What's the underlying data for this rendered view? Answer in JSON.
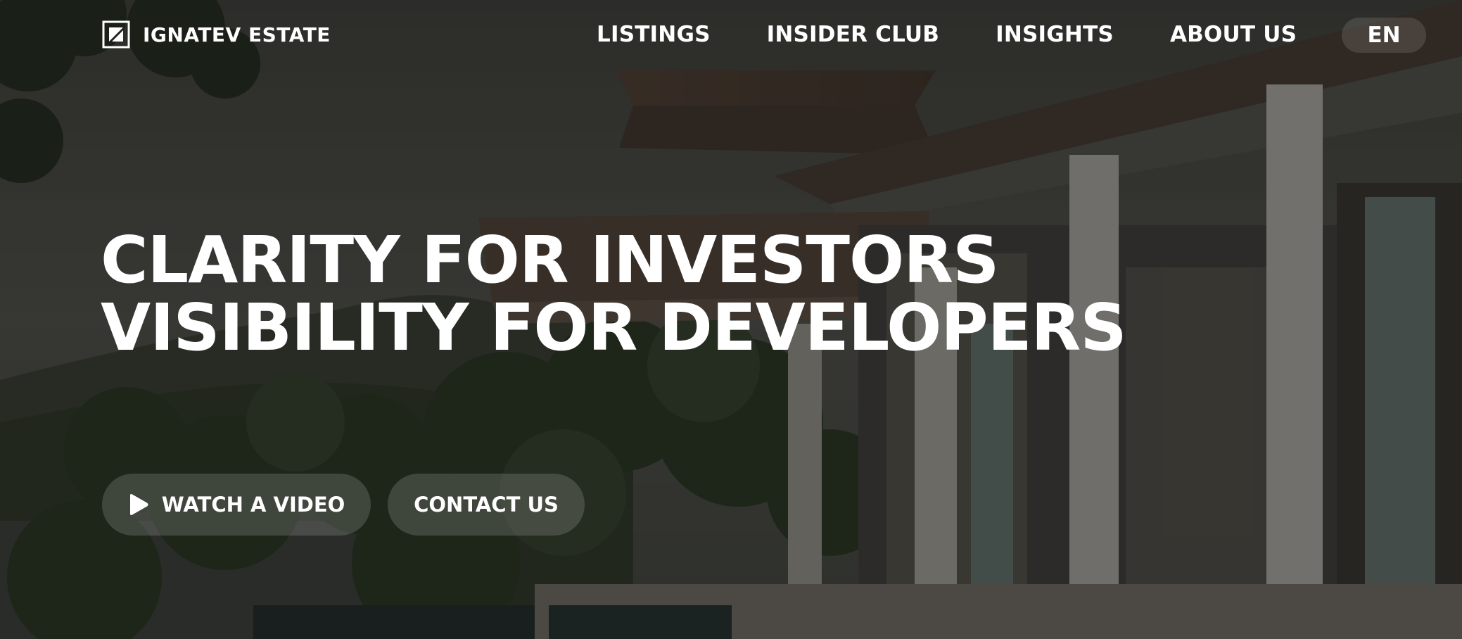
{
  "brand": {
    "name": "IGNATEV ESTATE",
    "logo_icon": "square-logo-icon"
  },
  "nav": {
    "items": [
      {
        "label": "LISTINGS"
      },
      {
        "label": "INSIDER CLUB"
      },
      {
        "label": "INSIGHTS"
      },
      {
        "label": "ABOUT US"
      }
    ],
    "language": "EN"
  },
  "hero": {
    "headline_line_1": "CLARITY FOR INVESTORS",
    "headline_line_2": "VISIBILITY FOR DEVELOPERS",
    "watch_video_label": "WATCH A VIDEO",
    "watch_video_icon": "play-icon",
    "contact_label": "CONTACT US"
  },
  "colors": {
    "text": "#ffffff",
    "overlay": "#141412",
    "pill_bg": "rgba(255,255,255,0.15)"
  }
}
